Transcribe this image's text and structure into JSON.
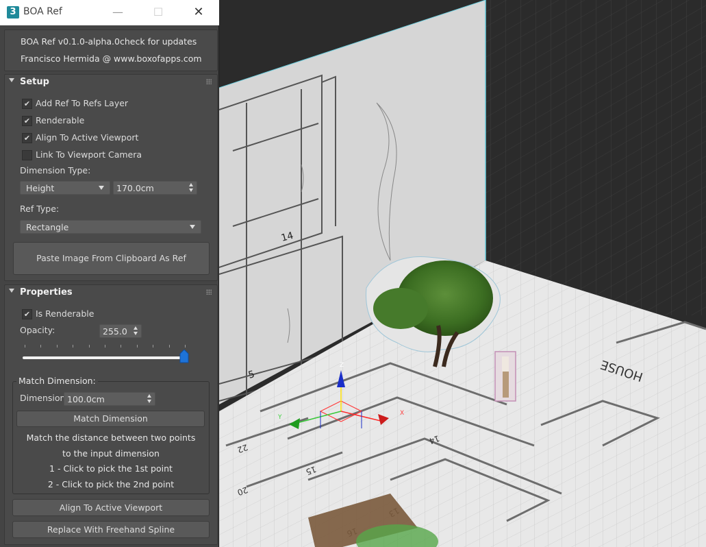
{
  "window": {
    "title": "BOA Ref",
    "app_icon_glyph": "3",
    "app_icon_color": "#1f8a9a"
  },
  "about": {
    "version_text": "BOA Ref v0.1.0-alpha.0",
    "update_link": "check for updates",
    "author_line": "Francisco Hermida @ www.boxofapps.com"
  },
  "setup": {
    "title": "Setup",
    "checkboxes": [
      {
        "label": "Add Ref To Refs Layer",
        "checked": true
      },
      {
        "label": "Renderable",
        "checked": true
      },
      {
        "label": "Align To Active Viewport",
        "checked": true
      },
      {
        "label": "Link To Viewport Camera",
        "checked": false
      }
    ],
    "dimension_type_label": "Dimension Type:",
    "dimension_type_value": "Height",
    "dimension_value": "170.0cm",
    "ref_type_label": "Ref Type:",
    "ref_type_value": "Rectangle",
    "paste_button": "Paste Image From Clipboard As Ref"
  },
  "properties": {
    "title": "Properties",
    "is_renderable_label": "Is Renderable",
    "is_renderable_checked": true,
    "opacity_label": "Opacity:",
    "opacity_value": "255.0",
    "opacity_slider_fraction": 1.0,
    "match": {
      "legend": "Match Dimension:",
      "dimension_label": "Dimension",
      "dimension_value": "100.0cm",
      "button": "Match Dimension",
      "info": [
        "Match the distance between two points",
        "to the input dimension",
        "1 - Click to pick the 1st point",
        "2 - Click to pick the 2nd point"
      ]
    },
    "align_button": "Align To Active Viewport",
    "replace_button": "Replace With Freehand Spline"
  },
  "viewport": {
    "background": "#2c2c2c",
    "labels": {
      "axis_x": "X",
      "axis_y": "Y",
      "axis_z": "Z",
      "elev_14": "14",
      "elev_5": "5",
      "plan_house": "HOUSE",
      "plan_13": "13",
      "plan_16": "16",
      "plan_20": "20",
      "plan_14": "14",
      "plan_15": "15",
      "plan_22": "22"
    }
  }
}
